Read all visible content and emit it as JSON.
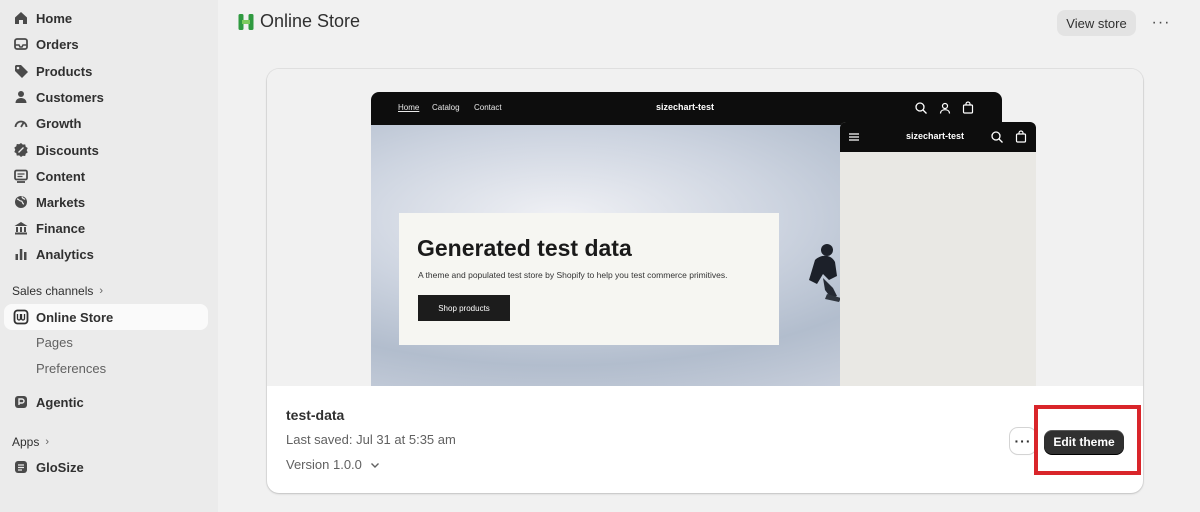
{
  "sidebar": {
    "items": [
      {
        "label": "Home",
        "icon": "home-icon"
      },
      {
        "label": "Orders",
        "icon": "orders-icon"
      },
      {
        "label": "Products",
        "icon": "tag-icon"
      },
      {
        "label": "Customers",
        "icon": "person-icon"
      },
      {
        "label": "Growth",
        "icon": "gauge-icon"
      },
      {
        "label": "Discounts",
        "icon": "discount-icon"
      },
      {
        "label": "Content",
        "icon": "content-icon"
      },
      {
        "label": "Markets",
        "icon": "globe-icon"
      },
      {
        "label": "Finance",
        "icon": "bank-icon"
      },
      {
        "label": "Analytics",
        "icon": "bar-chart-icon"
      }
    ],
    "sales_channels_label": "Sales channels",
    "online_store_label": "Online Store",
    "sub_items": [
      "Pages",
      "Preferences"
    ],
    "agentic_label": "Agentic",
    "apps_label": "Apps",
    "glosize_label": "GloSize"
  },
  "header": {
    "title": "Online Store",
    "view_store_label": "View store",
    "more_label": "···"
  },
  "preview": {
    "nav": [
      "Home",
      "Catalog",
      "Contact"
    ],
    "brand": "sizechart-test",
    "hero_title": "Generated test data",
    "hero_subtitle": "A theme and populated test store by Shopify to help you test commerce primitives.",
    "hero_button": "Shop products"
  },
  "theme": {
    "name": "test-data",
    "last_saved": "Last saved: Jul 31 at 5:35 am",
    "version": "Version 1.0.0",
    "more_label": "···",
    "edit_label": "Edit theme"
  },
  "colors": {
    "highlight": "#d9252a",
    "primary_button": "#303030",
    "brand_green": "#2f9a40"
  }
}
